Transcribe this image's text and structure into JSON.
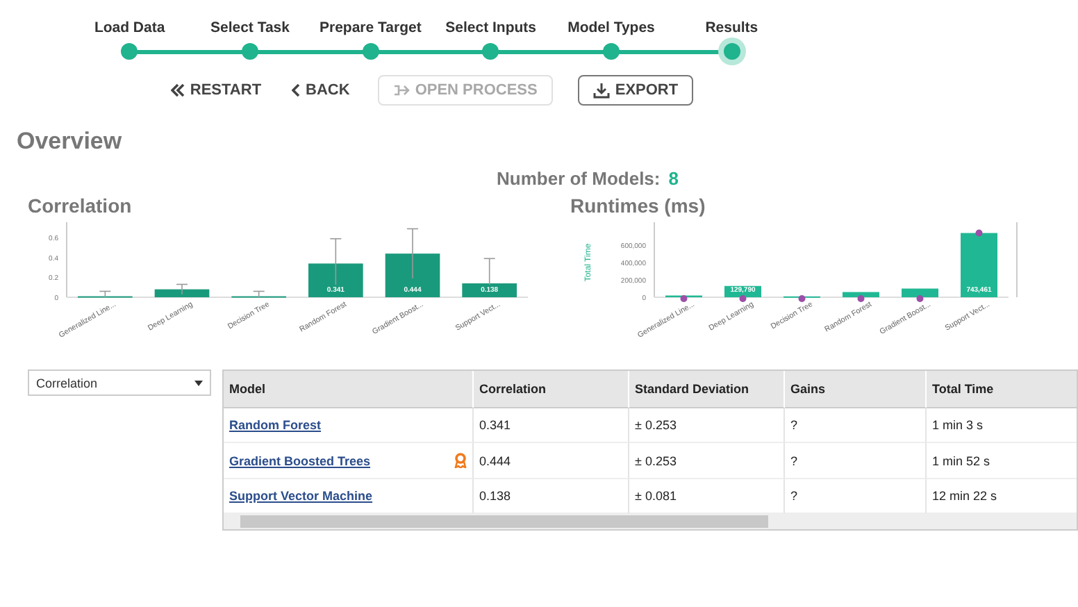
{
  "stepper": {
    "steps": [
      {
        "label": "Load Data",
        "selected": false
      },
      {
        "label": "Select Task",
        "selected": false
      },
      {
        "label": "Prepare Target",
        "selected": false
      },
      {
        "label": "Select Inputs",
        "selected": false
      },
      {
        "label": "Model Types",
        "selected": false
      },
      {
        "label": "Results",
        "selected": true
      }
    ]
  },
  "actions": [
    {
      "label": "RESTART",
      "kind": "restart",
      "disabled": false
    },
    {
      "label": "BACK",
      "kind": "back",
      "disabled": false
    },
    {
      "label": "OPEN PROCESS",
      "kind": "open",
      "disabled": true
    },
    {
      "label": "EXPORT",
      "kind": "export",
      "disabled": false
    }
  ],
  "overview": {
    "title": "Overview",
    "models_label": "Number of Models:",
    "models_count": "8"
  },
  "charts": [
    {
      "title": "Correlation",
      "chart_data": {
        "type": "bar",
        "categories": [
          "Generalized Line...",
          "Deep Learning",
          "Decision Tree",
          "Random Forest",
          "Gradient Boost...",
          "Support Vect..."
        ],
        "series": [
          {
            "color": "#1a9a7c",
            "values": [
              0.01,
              0.08,
              0.01,
              0.34,
              0.44,
              0.14
            ]
          }
        ],
        "ylim": [
          0,
          0.7
        ],
        "yticks": [
          {
            "value": 0,
            "label": "0"
          },
          {
            "value": 0.2,
            "label": "0.2"
          },
          {
            "value": 0.4,
            "label": "0.4"
          },
          {
            "value": 0.6,
            "label": "0.6"
          }
        ],
        "value_labels": [
          null,
          null,
          null,
          "0.341",
          "0.444",
          "0.138"
        ]
      }
    },
    {
      "title": "Runtimes (ms)",
      "chart_data": {
        "type": "bar",
        "ylabel": "Total Time",
        "categories": [
          "Generalized Line...",
          "Deep Learning",
          "Decision Tree",
          "Random Forest",
          "Gradient Boost...",
          "Support Vect..."
        ],
        "series": [
          {
            "color": "#20b894",
            "values": [
              20000,
              130000,
              10000,
              60000,
              100000,
              740000
            ]
          }
        ],
        "ylim": [
          0,
          800000
        ],
        "yticks": [
          {
            "value": 0,
            "label": "0"
          },
          {
            "value": 200000,
            "label": "200,000"
          },
          {
            "value": 400000,
            "label": "400,000"
          },
          {
            "value": 600000,
            "label": "600,000"
          }
        ],
        "value_labels": [
          null,
          "129,790",
          null,
          null,
          null,
          "743,461"
        ]
      }
    }
  ],
  "metric_select": {
    "value": "Correlation"
  },
  "table": {
    "columns": [
      "Model",
      "Correlation",
      "Standard Deviation",
      "Gains",
      "Total Time"
    ],
    "rows": [
      {
        "best": false,
        "cells": [
          "Random Forest",
          "0.341",
          "± 0.253",
          "?",
          "1 min 3 s"
        ]
      },
      {
        "best": true,
        "cells": [
          "Gradient Boosted Trees",
          "0.444",
          "± 0.253",
          "?",
          "1 min 52 s"
        ]
      },
      {
        "best": false,
        "cells": [
          "Support Vector Machine",
          "0.138",
          "± 0.081",
          "?",
          "12 min 22 s"
        ]
      }
    ]
  }
}
